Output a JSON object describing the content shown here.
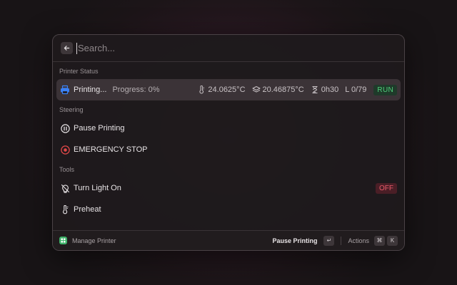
{
  "search": {
    "placeholder": "Search..."
  },
  "sections": {
    "printer_status": "Printer Status",
    "steering": "Steering",
    "tools": "Tools"
  },
  "status_row": {
    "title": "Printing...",
    "progress": "Progress: 0%",
    "hotend_temp": "24.0625°C",
    "bed_temp": "20.46875°C",
    "time": "0h30",
    "layer": "L 0/79",
    "state": "RUN"
  },
  "steering": {
    "pause": "Pause Printing",
    "emergency": "EMERGENCY STOP"
  },
  "tools": {
    "light": "Turn Light On",
    "light_state": "OFF",
    "preheat": "Preheat"
  },
  "footer": {
    "app_name": "Manage Printer",
    "primary_action": "Pause Printing",
    "enter_key": "↵",
    "actions_label": "Actions",
    "cmd_key": "⌘",
    "k_key": "K"
  },
  "colors": {
    "accent_run": "#4fd07a",
    "accent_off": "#e85a6a",
    "printer_icon": "#3b82f6",
    "emergency_icon": "#e04848",
    "app_logo": "#3fb36a"
  }
}
